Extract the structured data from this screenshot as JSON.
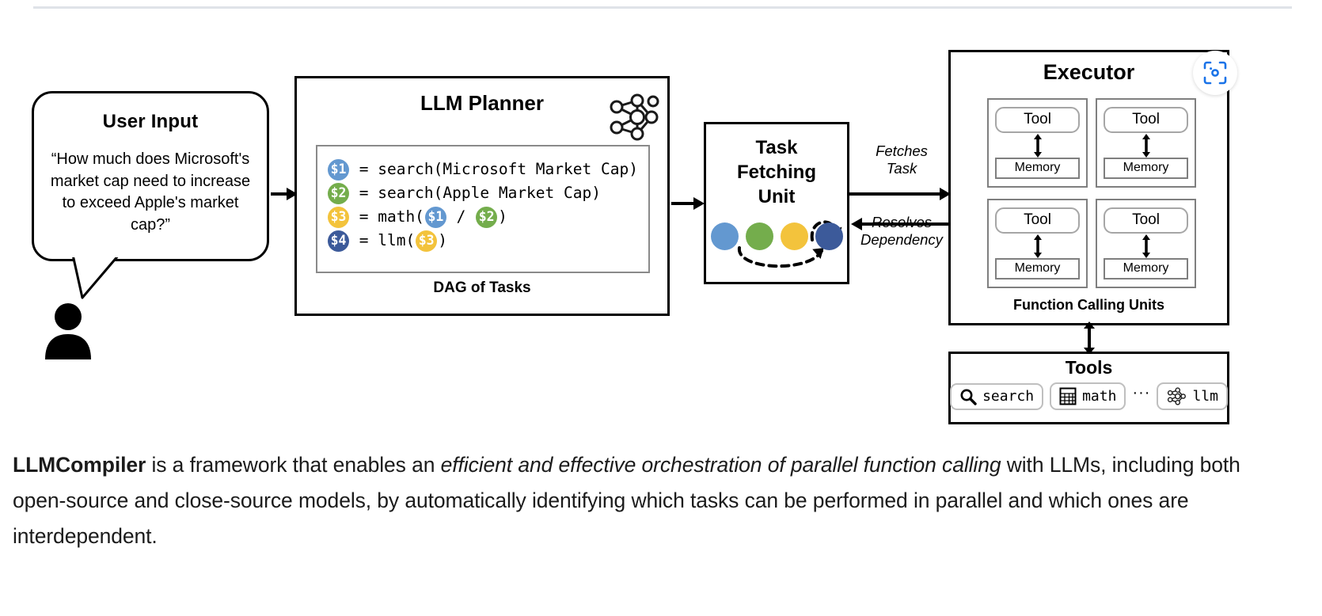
{
  "diagram": {
    "user_input": {
      "title": "User Input",
      "question": "“How much does Microsoft's market cap need to increase to exceed Apple's market cap?”",
      "avatar_icon": "person-icon"
    },
    "planner": {
      "title": "LLM Planner",
      "icon": "neural-network-icon",
      "dag_caption": "DAG of Tasks",
      "lines": [
        {
          "var": "$1",
          "var_color": "#6398d0",
          "text": " = search(Microsoft Market Cap)"
        },
        {
          "var": "$2",
          "var_color": "#74ad4c",
          "text": " = search(Apple Market Cap)"
        },
        {
          "var": "$3",
          "var_color": "#f3c33c",
          "text": " = math(",
          "args": [
            "$1",
            " / ",
            "$2"
          ],
          "suffix": ")"
        },
        {
          "var": "$4",
          "var_color": "#3c5a9a",
          "text": " = llm(",
          "args": [
            "$3"
          ],
          "suffix": ")"
        }
      ]
    },
    "task_fetching_unit": {
      "title_lines": [
        "Task",
        "Fetching",
        "Unit"
      ],
      "dots": [
        "#6398d0",
        "#74ad4c",
        "#f3c33c",
        "#3c5a9a"
      ]
    },
    "executor": {
      "title": "Executor",
      "caption": "Function Calling Units",
      "units": [
        {
          "tool": "Tool",
          "memory": "Memory"
        },
        {
          "tool": "Tool",
          "memory": "Memory"
        },
        {
          "tool": "Tool",
          "memory": "Memory"
        },
        {
          "tool": "Tool",
          "memory": "Memory"
        }
      ]
    },
    "tools": {
      "title": "Tools",
      "chips": [
        {
          "label": "search",
          "icon": "magnifier-icon"
        },
        {
          "label": "math",
          "icon": "calculator-icon"
        },
        {
          "label": "llm",
          "icon": "neural-network-icon"
        }
      ],
      "ellipsis": "···"
    },
    "edges": {
      "fetches_task": "Fetches\nTask",
      "resolves_dependency": "Resolves\nDependency"
    }
  },
  "overlay": {
    "lens_button_icon": "lens-scan-icon",
    "lens_button_color": "#1a73e8"
  },
  "caption": {
    "part1_bold": "LLMCompiler",
    "part2": " is a framework that enables an ",
    "part3_italic": "efficient and effective orchestration of parallel function calling",
    "part4": " with LLMs, including both open-source and close-source models, by automatically identifying which tasks can be performed in parallel and which ones are interdependent."
  }
}
